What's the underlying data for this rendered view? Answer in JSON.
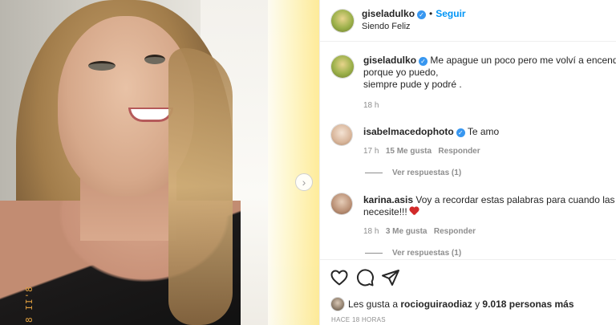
{
  "post": {
    "author": "giseladulko",
    "verified": true,
    "follow_label": "Seguir",
    "location": "Siendo Feliz",
    "photo_stamp": "8 II'8"
  },
  "caption": {
    "username": "giseladulko",
    "line1": "Me apague un poco pero me volví a encender .",
    "line2": "porque yo puedo,",
    "line3": "siempre pude y podré .",
    "time": "18 h"
  },
  "comments": [
    {
      "username": "isabelmacedophoto",
      "verified": true,
      "text": "Te amo",
      "time": "17 h",
      "likes": "15 Me gusta",
      "reply_label": "Responder",
      "view_replies": "Ver respuestas (1)"
    },
    {
      "username": "karina.asis",
      "verified": false,
      "text_line1": "Voy a recordar estas palabras para cuando las",
      "text_line2": "necesite!!!",
      "time": "18 h",
      "likes": "3 Me gusta",
      "reply_label": "Responder",
      "view_replies": "Ver respuestas (1)"
    }
  ],
  "likes_summary": {
    "prefix": "Les gusta a",
    "user": "rocioguiraodiaz",
    "connector": "y",
    "others": "9.018 personas más"
  },
  "posted_ago": "HACE 18 HORAS",
  "icons": [
    "heart-outline-icon",
    "comment-icon",
    "share-icon",
    "chevron-right-icon",
    "verified-badge-icon"
  ],
  "colors": {
    "accent": "#0095f6",
    "verified": "#3897f0",
    "heart": "#d12a2a",
    "muted": "#8e8e8e"
  }
}
